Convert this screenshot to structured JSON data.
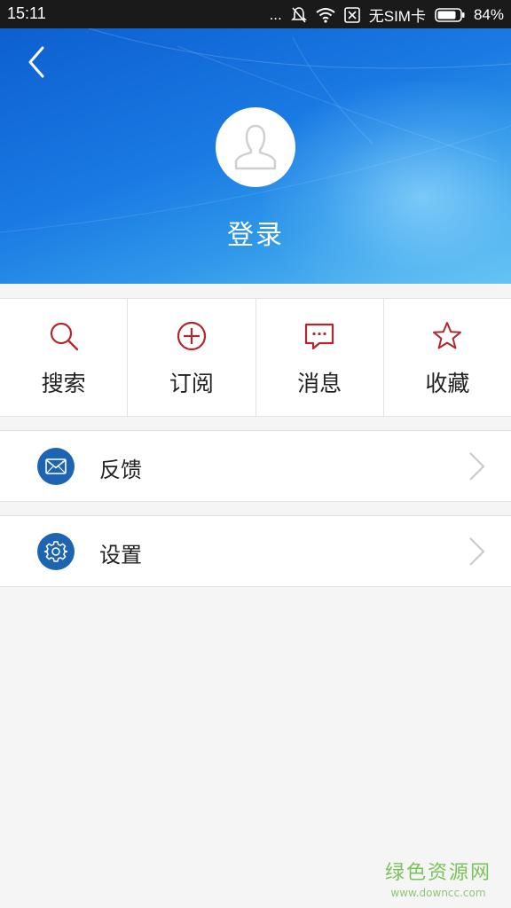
{
  "status_bar": {
    "time": "15:11",
    "more": "...",
    "sim": "无SIM卡",
    "battery": "84%"
  },
  "header": {
    "login_label": "登录"
  },
  "quick_actions": [
    {
      "label": "搜索",
      "icon": "search-icon"
    },
    {
      "label": "订阅",
      "icon": "plus-circle-icon"
    },
    {
      "label": "消息",
      "icon": "message-icon"
    },
    {
      "label": "收藏",
      "icon": "star-icon"
    }
  ],
  "list": [
    {
      "label": "反馈",
      "icon": "mail-icon"
    },
    {
      "label": "设置",
      "icon": "gear-icon"
    }
  ],
  "watermark": {
    "title": "绿色资源网",
    "url": "www.downcc.com"
  },
  "colors": {
    "accent_red": "#b0282e",
    "icon_blue": "#1d65b3",
    "header_blue": "#1a7ae3"
  }
}
